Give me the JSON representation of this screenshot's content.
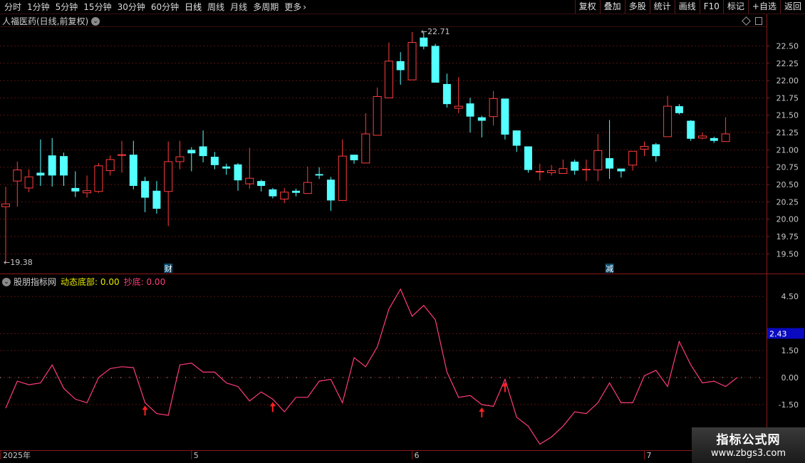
{
  "toolbar": {
    "periods": [
      "分时",
      "1分钟",
      "5分钟",
      "15分钟",
      "30分钟",
      "60分钟",
      "日线",
      "周线",
      "月线",
      "多周期"
    ],
    "active": "日线",
    "more": "更多",
    "right_buttons": [
      "复权",
      "叠加",
      "多股",
      "统计",
      "画线",
      "F10",
      "标记",
      "+自选",
      "返回"
    ]
  },
  "main_panel": {
    "title": "人福医药(日线,前复权)",
    "high_label": "22.71",
    "low_label": "19.38",
    "markers": [
      {
        "text": "财",
        "index": 14
      },
      {
        "text": "减",
        "index": 52
      }
    ],
    "y_ticks": [
      "22.50",
      "22.25",
      "22.00",
      "21.75",
      "21.50",
      "21.25",
      "21.00",
      "20.75",
      "20.50",
      "20.25",
      "20.00",
      "19.75",
      "19.50"
    ]
  },
  "indicator_panel": {
    "name": "股朋指标网",
    "line_a_label": "动态底部:",
    "line_a_value": "0.00",
    "line_b_label": "抄底:",
    "line_b_value": "0.00",
    "y_ticks": [
      "4.50",
      "1.50",
      "0.00",
      "-1.50"
    ],
    "current_value": "2.43"
  },
  "x_axis": {
    "labels": [
      "2025年",
      "5",
      "6",
      "7"
    ]
  },
  "watermark": {
    "line1": "指标公式网",
    "line2": "www.zbgs3.com"
  },
  "colors": {
    "up": "#ff3c3c",
    "down": "#54ffff",
    "line": "#ff3c78",
    "grid": "#5a1010",
    "arrow": "#ff2020"
  },
  "chart_data": {
    "type": "candlestick",
    "candles": [
      [
        20.18,
        20.22,
        19.38,
        20.47
      ],
      [
        20.55,
        20.71,
        20.18,
        20.83
      ],
      [
        20.45,
        20.61,
        20.39,
        20.72
      ],
      [
        20.67,
        20.63,
        20.48,
        21.15
      ],
      [
        20.92,
        20.63,
        20.47,
        21.17
      ],
      [
        20.91,
        20.63,
        20.48,
        20.96
      ],
      [
        20.45,
        20.4,
        20.32,
        20.69
      ],
      [
        20.38,
        20.41,
        20.31,
        20.63
      ],
      [
        20.4,
        20.77,
        20.38,
        20.81
      ],
      [
        20.7,
        20.86,
        20.63,
        20.92
      ],
      [
        20.93,
        20.93,
        20.67,
        21.13
      ],
      [
        20.93,
        20.48,
        20.43,
        21.13
      ],
      [
        20.55,
        20.31,
        20.1,
        20.61
      ],
      [
        20.41,
        20.15,
        20.08,
        20.55
      ],
      [
        20.4,
        20.83,
        19.9,
        21.12
      ],
      [
        20.83,
        20.9,
        20.72,
        21.13
      ],
      [
        21.0,
        20.95,
        20.69,
        21.04
      ],
      [
        21.05,
        20.91,
        20.82,
        21.28
      ],
      [
        20.9,
        20.78,
        20.72,
        20.97
      ],
      [
        20.76,
        20.73,
        20.64,
        20.8
      ],
      [
        20.79,
        20.56,
        20.41,
        20.81
      ],
      [
        20.51,
        20.59,
        20.44,
        21.03
      ],
      [
        20.55,
        20.48,
        20.4,
        20.57
      ],
      [
        20.43,
        20.33,
        20.3,
        20.45
      ],
      [
        20.29,
        20.39,
        20.23,
        20.45
      ],
      [
        20.41,
        20.38,
        20.33,
        20.44
      ],
      [
        20.37,
        20.53,
        20.37,
        20.76
      ],
      [
        20.65,
        20.63,
        20.58,
        20.75
      ],
      [
        20.57,
        20.27,
        20.12,
        20.61
      ],
      [
        20.27,
        20.91,
        20.27,
        21.15
      ],
      [
        20.93,
        20.85,
        20.8,
        20.93
      ],
      [
        20.81,
        21.23,
        20.81,
        21.53
      ],
      [
        21.21,
        21.77,
        21.21,
        21.9
      ],
      [
        21.75,
        22.28,
        21.75,
        22.55
      ],
      [
        22.28,
        22.15,
        21.94,
        22.41
      ],
      [
        22.01,
        22.55,
        22.01,
        22.7
      ],
      [
        22.62,
        22.49,
        22.45,
        22.71
      ],
      [
        22.5,
        21.97,
        21.97,
        22.53
      ],
      [
        21.95,
        21.66,
        21.61,
        22.1
      ],
      [
        21.6,
        21.63,
        21.53,
        22.05
      ],
      [
        21.67,
        21.48,
        21.25,
        21.75
      ],
      [
        21.47,
        21.42,
        21.18,
        21.49
      ],
      [
        21.48,
        21.74,
        21.35,
        21.85
      ],
      [
        21.74,
        21.22,
        21.15,
        21.74
      ],
      [
        21.28,
        21.06,
        20.97,
        21.28
      ],
      [
        21.05,
        20.71,
        20.67,
        21.05
      ],
      [
        20.69,
        20.69,
        20.56,
        20.8
      ],
      [
        20.67,
        20.7,
        20.63,
        20.78
      ],
      [
        20.66,
        20.73,
        20.66,
        20.86
      ],
      [
        20.83,
        20.7,
        20.64,
        20.86
      ],
      [
        20.71,
        20.72,
        20.55,
        20.86
      ],
      [
        20.71,
        20.99,
        20.55,
        21.23
      ],
      [
        20.88,
        20.73,
        20.58,
        21.43
      ],
      [
        20.73,
        20.69,
        20.6,
        20.72
      ],
      [
        20.78,
        20.98,
        20.7,
        20.97
      ],
      [
        21.01,
        21.05,
        20.91,
        21.12
      ],
      [
        21.08,
        20.91,
        20.83,
        21.1
      ],
      [
        21.19,
        21.63,
        21.19,
        21.78
      ],
      [
        21.63,
        21.53,
        21.51,
        21.66
      ],
      [
        21.42,
        21.16,
        21.13,
        21.43
      ],
      [
        21.17,
        21.2,
        21.15,
        21.25
      ],
      [
        21.17,
        21.13,
        21.1,
        21.19
      ],
      [
        21.12,
        21.23,
        21.12,
        21.47
      ]
    ],
    "indicator_series": [
      -1.7,
      -0.2,
      -0.4,
      -0.3,
      0.7,
      -0.6,
      -1.2,
      -1.4,
      0.0,
      0.5,
      0.6,
      0.55,
      -1.4,
      -2.0,
      -2.1,
      0.7,
      0.8,
      0.3,
      0.3,
      -0.3,
      -0.5,
      -1.3,
      -0.8,
      -1.2,
      -1.9,
      -1.1,
      -1.1,
      -0.2,
      -0.1,
      -1.4,
      1.1,
      0.6,
      1.7,
      3.8,
      4.9,
      3.4,
      4.0,
      3.2,
      0.3,
      -1.1,
      -1.0,
      -1.5,
      -1.6,
      -0.1,
      -2.2,
      -2.7,
      -3.7,
      -3.3,
      -2.7,
      -1.9,
      -2.0,
      -1.4,
      -0.3,
      -1.4,
      -1.4,
      0.1,
      0.4,
      -0.5,
      2.0,
      0.7,
      -0.3,
      -0.2,
      -0.5,
      0.0
    ],
    "arrows_at": [
      12,
      23,
      41,
      43
    ],
    "price_ylim": [
      19.38,
      22.71
    ],
    "indicator_ylim": [
      -3.75,
      5.0
    ]
  }
}
